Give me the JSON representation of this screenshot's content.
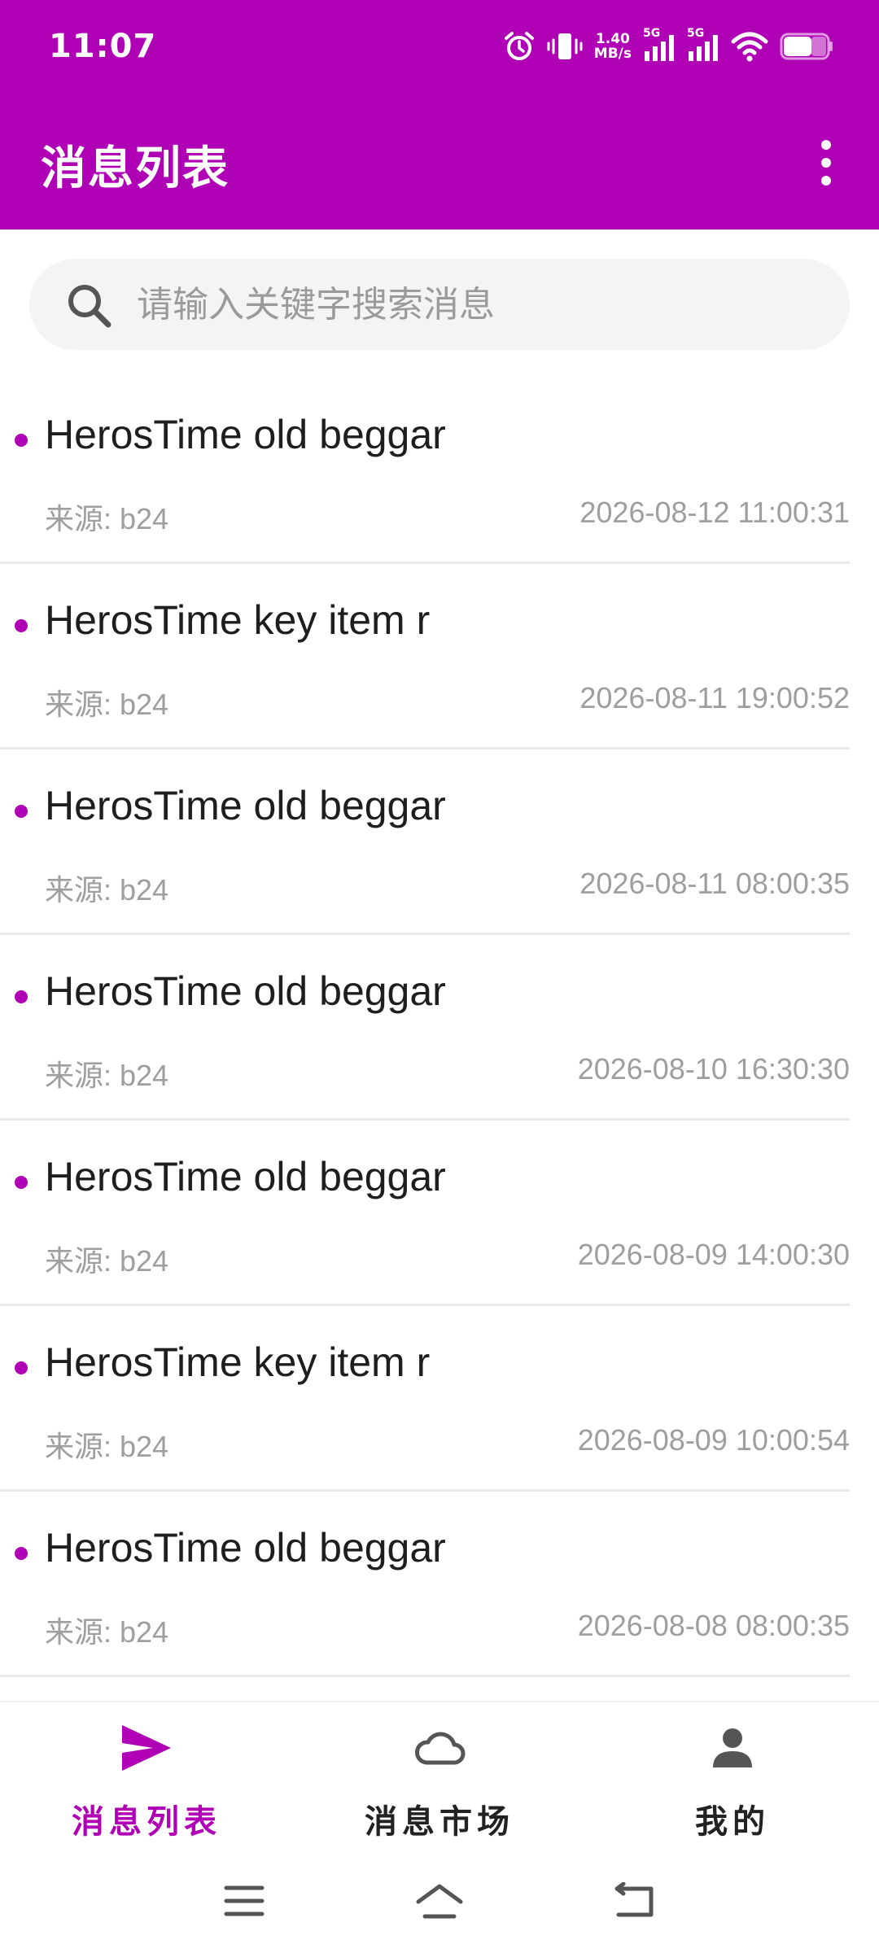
{
  "status_bar": {
    "time": "11:07",
    "net_speed_value": "1.40",
    "net_speed_unit": "MB/s",
    "sim1_label": "5G",
    "sim2_label": "5G",
    "icons": [
      "alarm-icon",
      "vibrate-icon",
      "signal-icon",
      "signal-icon",
      "wifi-icon",
      "battery-icon"
    ]
  },
  "app_bar": {
    "title": "消息列表",
    "menu_icon": "more-vertical-icon"
  },
  "search": {
    "placeholder": "请输入关键字搜索消息",
    "value": "",
    "icon": "search-icon"
  },
  "messages": [
    {
      "title": "HerosTime old beggar",
      "source": "来源: b24",
      "time": "2026-08-12 11:00:31"
    },
    {
      "title": "HerosTime key item r",
      "source": "来源: b24",
      "time": "2026-08-11 19:00:52"
    },
    {
      "title": "HerosTime old beggar",
      "source": "来源: b24",
      "time": "2026-08-11 08:00:35"
    },
    {
      "title": "HerosTime old beggar",
      "source": "来源: b24",
      "time": "2026-08-10 16:30:30"
    },
    {
      "title": "HerosTime old beggar",
      "source": "来源: b24",
      "time": "2026-08-09 14:00:30"
    },
    {
      "title": "HerosTime key item r",
      "source": "来源: b24",
      "time": "2026-08-09 10:00:54"
    },
    {
      "title": "HerosTime old beggar",
      "source": "来源: b24",
      "time": "2026-08-08 08:00:35"
    }
  ],
  "bottom_nav": {
    "items": [
      {
        "label": "消息列表",
        "icon": "send-icon",
        "active": true
      },
      {
        "label": "消息市场",
        "icon": "cloud-icon",
        "active": false
      },
      {
        "label": "我的",
        "icon": "person-icon",
        "active": false
      }
    ]
  },
  "colors": {
    "primary": "#b000b5",
    "text_primary": "#1e1e1e",
    "text_secondary": "#9e9e9e",
    "divider": "#e9e9e9",
    "search_bg": "#f4f4f4"
  }
}
